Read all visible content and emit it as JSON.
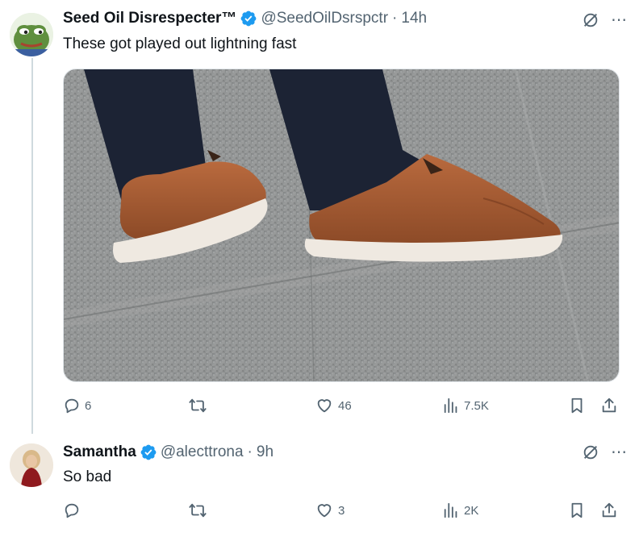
{
  "tweets": [
    {
      "display_name": "Seed Oil Disrespecter™",
      "handle": "@SeedOilDsrspctr",
      "separator": "·",
      "time": "14h",
      "text": "These got played out lightning fast",
      "stats": {
        "replies": "6",
        "retweets": "",
        "likes": "46",
        "views": "7.5K"
      },
      "avatar_icon": "frog-meme-avatar",
      "media": "photo of brown leather wingtip shoes with white soles on gray stone floor"
    },
    {
      "display_name": "Samantha",
      "handle": "@alecttrona",
      "separator": "·",
      "time": "9h",
      "text": "So bad",
      "stats": {
        "replies": "",
        "retweets": "",
        "likes": "3",
        "views": "2K"
      },
      "avatar_icon": "woman-in-red-avatar"
    }
  ],
  "colors": {
    "verified": "#1d9bf0",
    "secondary_text": "#536471",
    "thread_line": "#cfd9de",
    "shoe_leather": "#a65a32",
    "floor": "#8e9091"
  },
  "icons": {
    "more": "⋯",
    "grok": "grok-icon",
    "reply": "reply-icon",
    "retweet": "retweet-icon",
    "like": "heart-icon",
    "views": "analytics-icon",
    "bookmark": "bookmark-icon",
    "share": "share-icon"
  }
}
